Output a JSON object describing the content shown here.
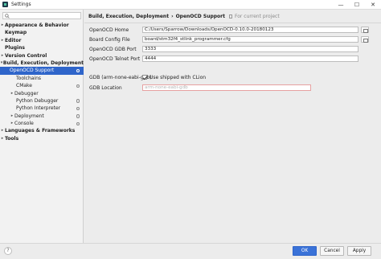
{
  "window": {
    "title": "Settings",
    "controls": [
      "—",
      "☐",
      "✕"
    ]
  },
  "sidebar": {
    "search_placeholder": "",
    "items": [
      {
        "label": "Appearance & Behavior",
        "bold": true,
        "expand": "▸"
      },
      {
        "label": "Keymap",
        "bold": true,
        "expand": ""
      },
      {
        "label": "Editor",
        "bold": true,
        "expand": "▸"
      },
      {
        "label": "Plugins",
        "bold": true,
        "expand": ""
      },
      {
        "label": "Version Control",
        "bold": true,
        "expand": "▸"
      },
      {
        "label": "Build, Execution, Deployment",
        "bold": true,
        "expand": "▾"
      },
      {
        "label": "OpenOCD Support",
        "bold": false,
        "expand": ""
      },
      {
        "label": "Toolchains",
        "bold": false,
        "expand": ""
      },
      {
        "label": "CMake",
        "bold": false,
        "expand": ""
      },
      {
        "label": "Debugger",
        "bold": false,
        "expand": "▸"
      },
      {
        "label": "Python Debugger",
        "bold": false,
        "expand": ""
      },
      {
        "label": "Python Interpreter",
        "bold": false,
        "expand": ""
      },
      {
        "label": "Deployment",
        "bold": false,
        "expand": "▸"
      },
      {
        "label": "Console",
        "bold": false,
        "expand": "▸"
      },
      {
        "label": "Languages & Frameworks",
        "bold": true,
        "expand": "▸"
      },
      {
        "label": "Tools",
        "bold": true,
        "expand": "▸"
      }
    ]
  },
  "breadcrumb": {
    "parent": "Build, Execution, Deployment",
    "separator": "›",
    "current": "OpenOCD Support",
    "scope": "For current project"
  },
  "form": {
    "openocd_home_label": "OpenOCD Home",
    "openocd_home_value": "C:/Users/Sparrow/Downloads/OpenOCD-0.10.0-20180123",
    "board_config_label": "Board Config File",
    "board_config_value": "board/stm32f4_stlink_programmer.cfg",
    "gdb_port_label": "OpenOCD GDB Port",
    "gdb_port_value": "3333",
    "telnet_port_label": "OpenOCD Telnet Port",
    "telnet_port_value": "4444",
    "gdb_label": "GDB (arm-none-eabi-gdb)",
    "use_shipped_label": "Use shipped with CLion",
    "use_shipped_checked": true,
    "gdb_location_label": "GDB Location",
    "gdb_location_placeholder": "arm-none-eabi-gdb"
  },
  "footer": {
    "help": "?",
    "ok": "OK",
    "cancel": "Cancel",
    "apply": "Apply"
  },
  "colors": {
    "selection": "#2f65ca",
    "error_border": "#e6a1a1"
  }
}
